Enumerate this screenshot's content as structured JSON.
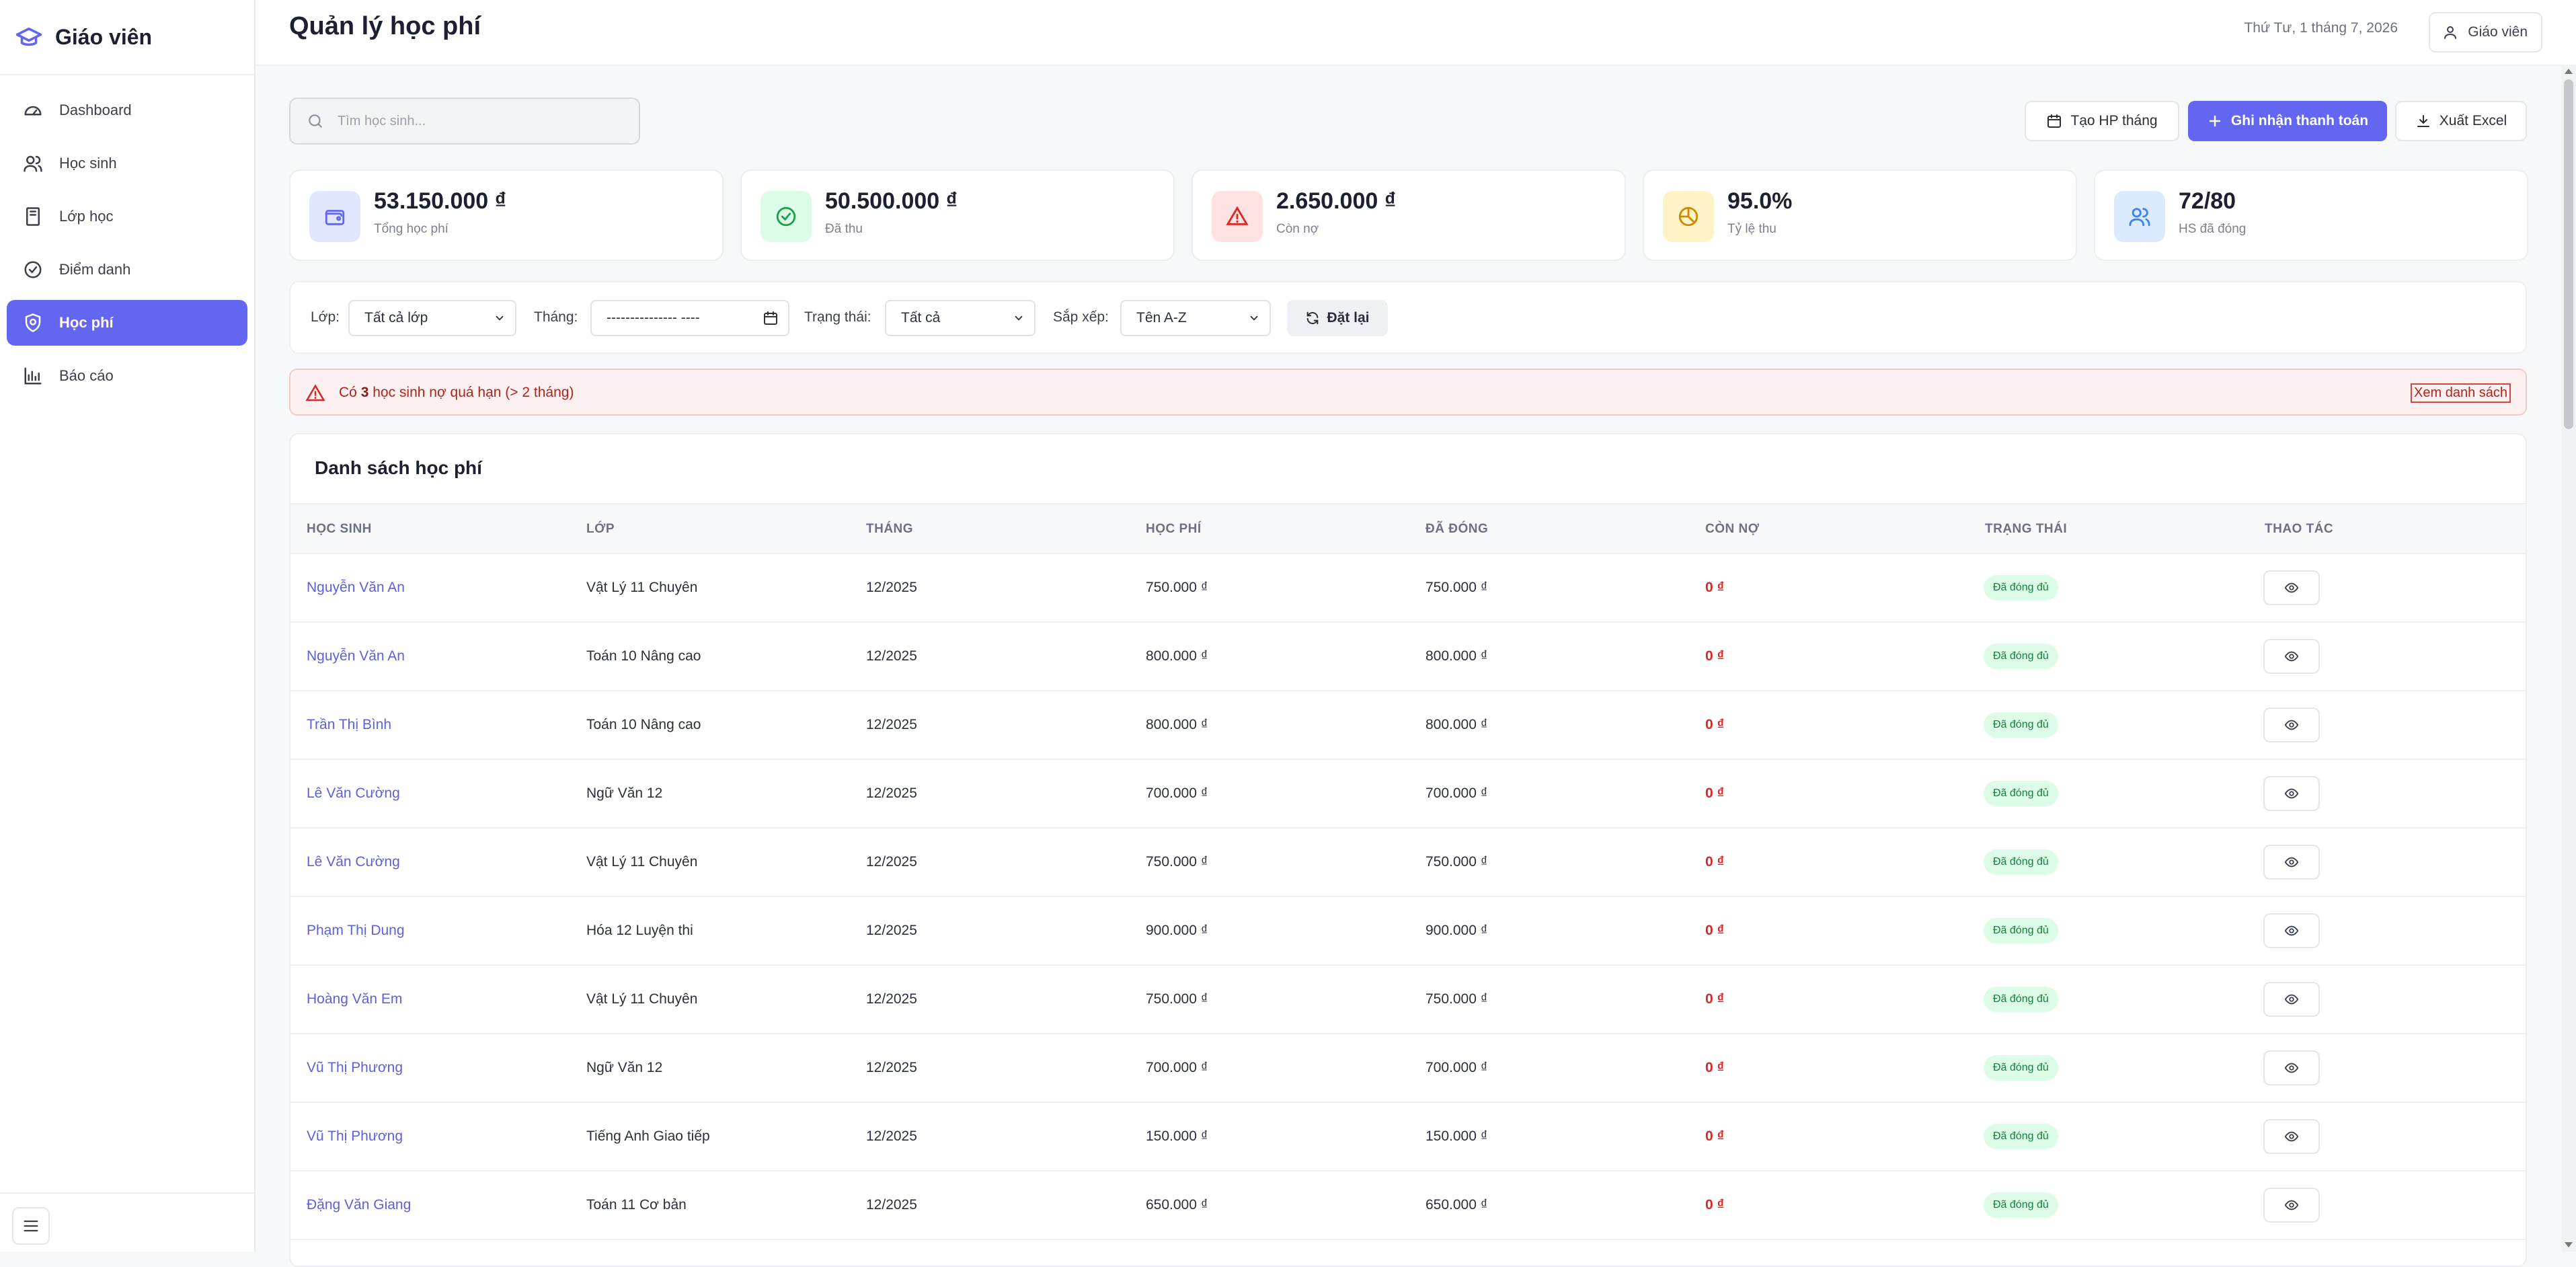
{
  "app": {
    "brand": "Giáo viên"
  },
  "sidebar": {
    "items": [
      {
        "label": "Dashboard",
        "icon": "dashboard-icon",
        "active": false
      },
      {
        "label": "Học sinh",
        "icon": "users-icon",
        "active": false
      },
      {
        "label": "Lớp học",
        "icon": "book-icon",
        "active": false
      },
      {
        "label": "Điểm danh",
        "icon": "check-circle-icon",
        "active": false
      },
      {
        "label": "Học phí",
        "icon": "shield-icon",
        "active": true
      },
      {
        "label": "Báo cáo",
        "icon": "bar-chart-icon",
        "active": false
      }
    ]
  },
  "header": {
    "title": "Quản lý học phí",
    "date": "Thứ Tư, 1 tháng 7, 2026",
    "user_label": "Giáo viên"
  },
  "search": {
    "placeholder": "Tìm học sinh...",
    "value": ""
  },
  "actions": {
    "create_label": "Tạo HP tháng",
    "record_label": "Ghi nhận thanh toán",
    "export_label": "Xuất Excel"
  },
  "stats": [
    {
      "value": "53.150.000 ₫",
      "label": "Tổng học phí",
      "icon": "wallet-icon",
      "color": "#6366f1",
      "bg": "#e0e7ff"
    },
    {
      "value": "50.500.000 ₫",
      "label": "Đã thu",
      "icon": "check-circle-icon",
      "color": "#16a34a",
      "bg": "#dcfce7"
    },
    {
      "value": "2.650.000 ₫",
      "label": "Còn nợ",
      "icon": "warning-icon",
      "color": "#dc2626",
      "bg": "#fee2e2"
    },
    {
      "value": "95.0%",
      "label": "Tỷ lệ thu",
      "icon": "pie-chart-icon",
      "color": "#ca8a04",
      "bg": "#fef3c7"
    },
    {
      "value": "72/80",
      "label": "HS đã đóng",
      "icon": "users-icon",
      "color": "#3b82f6",
      "bg": "#dbeafe"
    }
  ],
  "filters": {
    "class_label": "Lớp:",
    "class_value": "Tất cả lớp",
    "month_label": "Tháng:",
    "month_value": "--------------- ----",
    "status_label": "Trạng thái:",
    "status_value": "Tất cả",
    "sort_label": "Sắp xếp:",
    "sort_value": "Tên A-Z",
    "reset_label": "Đặt lại"
  },
  "alert": {
    "prefix": "Có ",
    "count": "3",
    "suffix": " học sinh nợ quá hạn (> 2 tháng)",
    "link": "Xem danh sách"
  },
  "table": {
    "title": "Danh sách học phí",
    "columns": [
      "HỌC SINH",
      "LỚP",
      "THÁNG",
      "HỌC PHÍ",
      "ĐÃ ĐÓNG",
      "CÒN NỢ",
      "TRẠNG THÁI",
      "THAO TÁC"
    ],
    "rows": [
      {
        "student": "Nguyễn Văn An",
        "class": "Vật Lý 11 Chuyên",
        "month": "12/2025",
        "fee": "750.000 ₫",
        "paid": "750.000 ₫",
        "debt": "0 ₫",
        "status": "Đã đóng đủ"
      },
      {
        "student": "Nguyễn Văn An",
        "class": "Toán 10 Nâng cao",
        "month": "12/2025",
        "fee": "800.000 ₫",
        "paid": "800.000 ₫",
        "debt": "0 ₫",
        "status": "Đã đóng đủ"
      },
      {
        "student": "Trần Thị Bình",
        "class": "Toán 10 Nâng cao",
        "month": "12/2025",
        "fee": "800.000 ₫",
        "paid": "800.000 ₫",
        "debt": "0 ₫",
        "status": "Đã đóng đủ"
      },
      {
        "student": "Lê Văn Cường",
        "class": "Ngữ Văn 12",
        "month": "12/2025",
        "fee": "700.000 ₫",
        "paid": "700.000 ₫",
        "debt": "0 ₫",
        "status": "Đã đóng đủ"
      },
      {
        "student": "Lê Văn Cường",
        "class": "Vật Lý 11 Chuyên",
        "month": "12/2025",
        "fee": "750.000 ₫",
        "paid": "750.000 ₫",
        "debt": "0 ₫",
        "status": "Đã đóng đủ"
      },
      {
        "student": "Phạm Thị Dung",
        "class": "Hóa 12 Luyện thi",
        "month": "12/2025",
        "fee": "900.000 ₫",
        "paid": "900.000 ₫",
        "debt": "0 ₫",
        "status": "Đã đóng đủ"
      },
      {
        "student": "Hoàng Văn Em",
        "class": "Vật Lý 11 Chuyên",
        "month": "12/2025",
        "fee": "750.000 ₫",
        "paid": "750.000 ₫",
        "debt": "0 ₫",
        "status": "Đã đóng đủ"
      },
      {
        "student": "Vũ Thị Phương",
        "class": "Ngữ Văn 12",
        "month": "12/2025",
        "fee": "700.000 ₫",
        "paid": "700.000 ₫",
        "debt": "0 ₫",
        "status": "Đã đóng đủ"
      },
      {
        "student": "Vũ Thị Phương",
        "class": "Tiếng Anh Giao tiếp",
        "month": "12/2025",
        "fee": "150.000 ₫",
        "paid": "150.000 ₫",
        "debt": "0 ₫",
        "status": "Đã đóng đủ"
      },
      {
        "student": "Đặng Văn Giang",
        "class": "Toán 11 Cơ bản",
        "month": "12/2025",
        "fee": "650.000 ₫",
        "paid": "650.000 ₫",
        "debt": "0 ₫",
        "status": "Đã đóng đủ"
      }
    ]
  },
  "colors": {
    "accent": "#6366f1",
    "danger": "#dc2626",
    "success": "#15803d"
  }
}
